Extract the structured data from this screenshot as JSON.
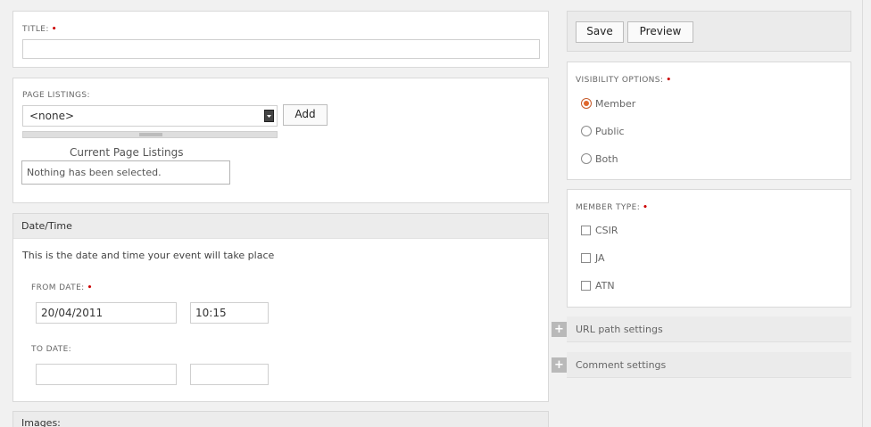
{
  "title_section": {
    "label": "TITLE:",
    "required_mark": "•",
    "value": ""
  },
  "page_listings": {
    "label": "PAGE LISTINGS:",
    "select_value": "<none>",
    "add_label": "Add",
    "current_heading": "Current Page Listings",
    "empty_text": "Nothing has been selected."
  },
  "datetime": {
    "header": "Date/Time",
    "description": "This is the date and time your event will take place",
    "from_label": "FROM DATE:",
    "required_mark": "•",
    "from_date": "20/04/2011",
    "from_time": "10:15",
    "to_label": "TO DATE:",
    "to_date": "",
    "to_time": ""
  },
  "images": {
    "header": "Images:"
  },
  "actions": {
    "save_label": "Save",
    "preview_label": "Preview"
  },
  "visibility": {
    "label": "VISIBILITY OPTIONS:",
    "required_mark": "•",
    "options": [
      {
        "label": "Member",
        "checked": true
      },
      {
        "label": "Public",
        "checked": false
      },
      {
        "label": "Both",
        "checked": false
      }
    ]
  },
  "member_type": {
    "label": "MEMBER TYPE:",
    "required_mark": "•",
    "options": [
      {
        "label": "CSIR",
        "checked": false
      },
      {
        "label": "JA",
        "checked": false
      },
      {
        "label": "ATN",
        "checked": false
      }
    ]
  },
  "collapsibles": {
    "expand_glyph": "+",
    "url_path": "URL path settings",
    "comment": "Comment settings"
  },
  "icons": {
    "dropdown": "chevron-down-icon",
    "resize": "grip-icon",
    "expand": "plus-icon"
  },
  "colors": {
    "required": "#cc0000",
    "radio_selected": "#e0672c"
  }
}
